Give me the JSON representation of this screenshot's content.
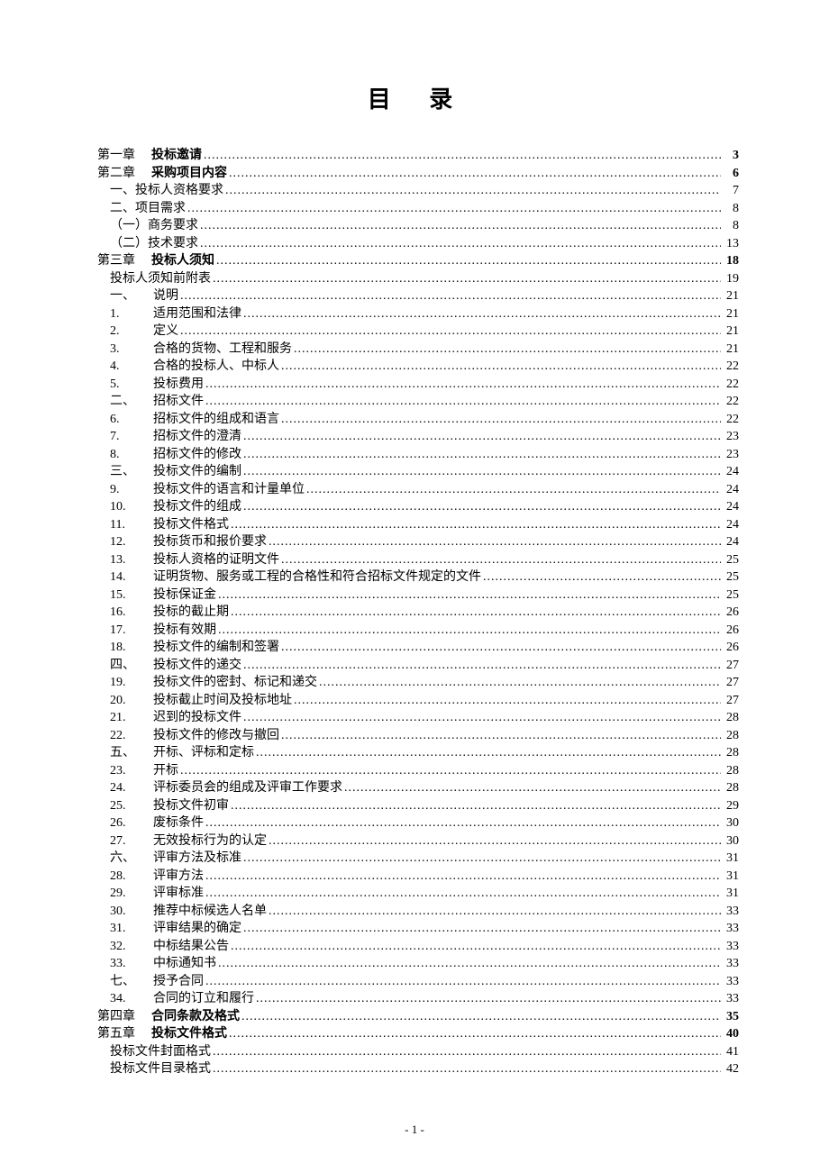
{
  "title": "目 录",
  "footer": "- 1 -",
  "entries": [
    {
      "num": "第一章",
      "label": "投标邀请",
      "page": "3",
      "bold": true,
      "indent": 0,
      "numClass": "num-wide"
    },
    {
      "num": "第二章",
      "label": "采购项目内容",
      "page": "6",
      "bold": true,
      "indent": 0,
      "numClass": "num-wide"
    },
    {
      "num": "",
      "label": "一、投标人资格要求",
      "page": "7",
      "bold": false,
      "indent": 1
    },
    {
      "num": "",
      "label": "二、项目需求",
      "page": "8",
      "bold": false,
      "indent": 1
    },
    {
      "num": "",
      "label": "（一）商务要求",
      "page": "8",
      "bold": false,
      "indent": 1
    },
    {
      "num": "",
      "label": "（二）技术要求",
      "page": "13",
      "bold": false,
      "indent": 1
    },
    {
      "num": "第三章",
      "label": "投标人须知",
      "page": "18",
      "bold": true,
      "indent": 0,
      "numClass": "num-wide"
    },
    {
      "num": "",
      "label": "投标人须知前附表",
      "page": "19",
      "bold": false,
      "indent": 1
    },
    {
      "num": "一、",
      "label": "说明",
      "page": "21",
      "bold": false,
      "indent": 2
    },
    {
      "num": "1.",
      "label": "适用范围和法律",
      "page": "21",
      "bold": false,
      "indent": 3
    },
    {
      "num": "2.",
      "label": "定义",
      "page": "21",
      "bold": false,
      "indent": 3
    },
    {
      "num": "3.",
      "label": "合格的货物、工程和服务",
      "page": "21",
      "bold": false,
      "indent": 3
    },
    {
      "num": "4.",
      "label": "合格的投标人、中标人",
      "page": "22",
      "bold": false,
      "indent": 3
    },
    {
      "num": "5.",
      "label": "投标费用",
      "page": "22",
      "bold": false,
      "indent": 3
    },
    {
      "num": "二、",
      "label": "招标文件",
      "page": "22",
      "bold": false,
      "indent": 2
    },
    {
      "num": "6.",
      "label": "招标文件的组成和语言",
      "page": "22",
      "bold": false,
      "indent": 3
    },
    {
      "num": "7.",
      "label": "招标文件的澄清",
      "page": "23",
      "bold": false,
      "indent": 3
    },
    {
      "num": "8.",
      "label": "招标文件的修改",
      "page": "23",
      "bold": false,
      "indent": 3
    },
    {
      "num": "三、",
      "label": "投标文件的编制",
      "page": "24",
      "bold": false,
      "indent": 2
    },
    {
      "num": "9.",
      "label": "投标文件的语言和计量单位",
      "page": "24",
      "bold": false,
      "indent": 3
    },
    {
      "num": "10.",
      "label": "投标文件的组成",
      "page": "24",
      "bold": false,
      "indent": 3
    },
    {
      "num": "11.",
      "label": "投标文件格式",
      "page": "24",
      "bold": false,
      "indent": 3
    },
    {
      "num": "12.",
      "label": "投标货币和报价要求",
      "page": "24",
      "bold": false,
      "indent": 3
    },
    {
      "num": "13.",
      "label": "投标人资格的证明文件",
      "page": "25",
      "bold": false,
      "indent": 3
    },
    {
      "num": "14.",
      "label": "证明货物、服务或工程的合格性和符合招标文件规定的文件",
      "page": "25",
      "bold": false,
      "indent": 3
    },
    {
      "num": "15.",
      "label": "投标保证金",
      "page": "25",
      "bold": false,
      "indent": 3
    },
    {
      "num": "16.",
      "label": "投标的截止期",
      "page": "26",
      "bold": false,
      "indent": 3
    },
    {
      "num": "17.",
      "label": "投标有效期",
      "page": "26",
      "bold": false,
      "indent": 3
    },
    {
      "num": "18.",
      "label": "投标文件的编制和签署",
      "page": "26",
      "bold": false,
      "indent": 3
    },
    {
      "num": "四、",
      "label": "投标文件的递交",
      "page": "27",
      "bold": false,
      "indent": 2
    },
    {
      "num": "19.",
      "label": "投标文件的密封、标记和递交",
      "page": "27",
      "bold": false,
      "indent": 3
    },
    {
      "num": "20.",
      "label": "投标截止时间及投标地址",
      "page": "27",
      "bold": false,
      "indent": 3
    },
    {
      "num": "21.",
      "label": "迟到的投标文件",
      "page": "28",
      "bold": false,
      "indent": 3
    },
    {
      "num": "22.",
      "label": "投标文件的修改与撤回",
      "page": "28",
      "bold": false,
      "indent": 3
    },
    {
      "num": "五、",
      "label": "开标、评标和定标",
      "page": "28",
      "bold": false,
      "indent": 2
    },
    {
      "num": "23.",
      "label": "开标",
      "page": "28",
      "bold": false,
      "indent": 3
    },
    {
      "num": "24.",
      "label": "评标委员会的组成及评审工作要求",
      "page": "28",
      "bold": false,
      "indent": 3
    },
    {
      "num": "25.",
      "label": "投标文件初审",
      "page": "29",
      "bold": false,
      "indent": 3
    },
    {
      "num": "26.",
      "label": "废标条件",
      "page": "30",
      "bold": false,
      "indent": 3
    },
    {
      "num": "27.",
      "label": "无效投标行为的认定",
      "page": "30",
      "bold": false,
      "indent": 3
    },
    {
      "num": "六、",
      "label": "评审方法及标准",
      "page": "31",
      "bold": false,
      "indent": 2
    },
    {
      "num": "28.",
      "label": "评审方法",
      "page": "31",
      "bold": false,
      "indent": 3
    },
    {
      "num": "29.",
      "label": "评审标准",
      "page": "31",
      "bold": false,
      "indent": 3
    },
    {
      "num": "30.",
      "label": "推荐中标候选人名单",
      "page": "33",
      "bold": false,
      "indent": 3
    },
    {
      "num": "31.",
      "label": "评审结果的确定",
      "page": "33",
      "bold": false,
      "indent": 3
    },
    {
      "num": "32.",
      "label": "中标结果公告",
      "page": "33",
      "bold": false,
      "indent": 3
    },
    {
      "num": "33.",
      "label": "中标通知书",
      "page": "33",
      "bold": false,
      "indent": 3
    },
    {
      "num": "七、",
      "label": "授予合同",
      "page": "33",
      "bold": false,
      "indent": 2
    },
    {
      "num": "34.",
      "label": "合同的订立和履行",
      "page": "33",
      "bold": false,
      "indent": 3
    },
    {
      "num": "第四章",
      "label": "合同条款及格式",
      "page": "35",
      "bold": true,
      "indent": 0,
      "numClass": "num-wide"
    },
    {
      "num": "第五章",
      "label": "投标文件格式",
      "page": "40",
      "bold": true,
      "indent": 0,
      "numClass": "num-wide"
    },
    {
      "num": "",
      "label": "投标文件封面格式",
      "page": "41",
      "bold": false,
      "indent": 1
    },
    {
      "num": "",
      "label": "投标文件目录格式",
      "page": "42",
      "bold": false,
      "indent": 1
    }
  ]
}
